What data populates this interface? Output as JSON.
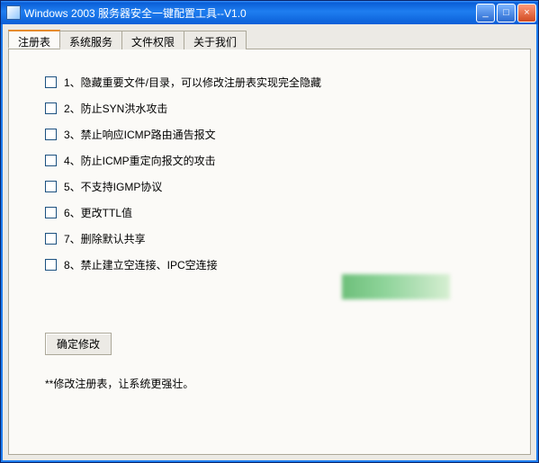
{
  "window": {
    "title": "Windows 2003 服务器安全一键配置工具--V1.0"
  },
  "tabs": [
    "注册表",
    "系统服务",
    "文件权限",
    "关于我们"
  ],
  "options": [
    "1、隐藏重要文件/目录，可以修改注册表实现完全隐藏",
    "2、防止SYN洪水攻击",
    "3、禁止响应ICMP路由通告报文",
    "4、防止ICMP重定向报文的攻击",
    "5、不支持IGMP协议",
    "6、更改TTL值",
    "7、删除默认共享",
    "8、禁止建立空连接、IPC空连接"
  ],
  "confirm_label": "确定修改",
  "hint_text": "**修改注册表，让系统更强壮。",
  "win_buttons": {
    "min": "_",
    "max": "□",
    "close": "×"
  }
}
